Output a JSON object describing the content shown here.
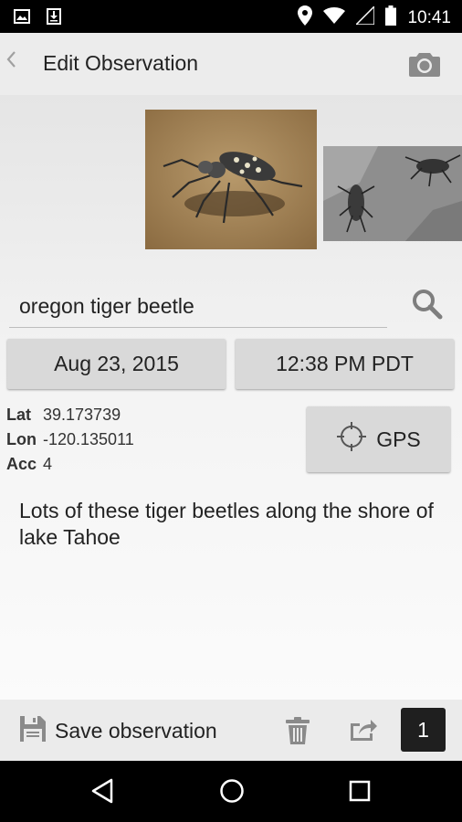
{
  "status_bar": {
    "time": "10:41",
    "icons": [
      "image-notification-icon",
      "download-notification-icon",
      "location-icon",
      "wifi-icon",
      "signal-icon",
      "battery-icon"
    ]
  },
  "app_bar": {
    "title": "Edit Observation",
    "back_icon": "chevron-left-icon",
    "action_icon": "camera-icon"
  },
  "photos": [
    {
      "name": "tiger-beetle-photo-1",
      "selected": true
    },
    {
      "name": "tiger-beetle-photo-2",
      "selected": false
    }
  ],
  "species": {
    "value": "oregon tiger beetle"
  },
  "datetime": {
    "date": "Aug 23, 2015",
    "time": "12:38 PM PDT"
  },
  "location": {
    "lat_label": "Lat",
    "lat": "39.173739",
    "lon_label": "Lon",
    "lon": "-120.135011",
    "acc_label": "Acc",
    "acc": "4",
    "gps_label": "GPS"
  },
  "notes": "Lots of these tiger beetles along the shore of lake Tahoe",
  "bottom_bar": {
    "save_label": "Save observation",
    "count": "1"
  },
  "colors": {
    "status_bar": "#000000",
    "app_bar": "#ececec",
    "button": "#d9d9d9",
    "counter": "#1f1f1f"
  }
}
